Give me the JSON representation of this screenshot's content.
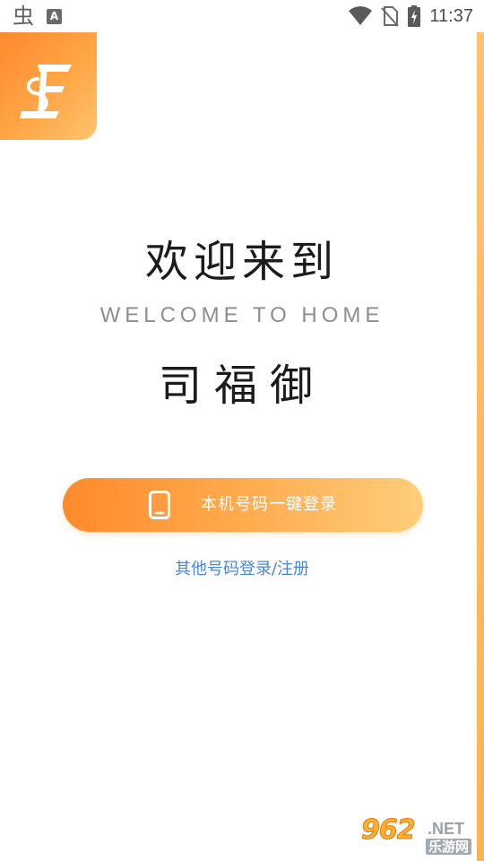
{
  "status_bar": {
    "time": "11:37",
    "left_icons": [
      "bug-icon",
      "text-a-icon"
    ],
    "right_icons": [
      "wifi-icon",
      "no-sim-icon",
      "battery-charging-icon"
    ],
    "text_a": "A"
  },
  "brand": {
    "accent_start": "#ff8a2c",
    "accent_end": "#ffcd7a",
    "link_color": "#4a86d4",
    "logo_icon": "sf-logo-icon"
  },
  "welcome": {
    "title": "欢迎来到",
    "subtitle": "WELCOME TO HOME",
    "app_name": "司福御"
  },
  "actions": {
    "one_tap_login_label": "本机号码一键登录",
    "one_tap_login_icon": "phone-icon",
    "other_login_label": "其他号码登录/注册"
  },
  "watermark": {
    "number": "962",
    "suffix": ".NET",
    "site": "乐游网"
  }
}
